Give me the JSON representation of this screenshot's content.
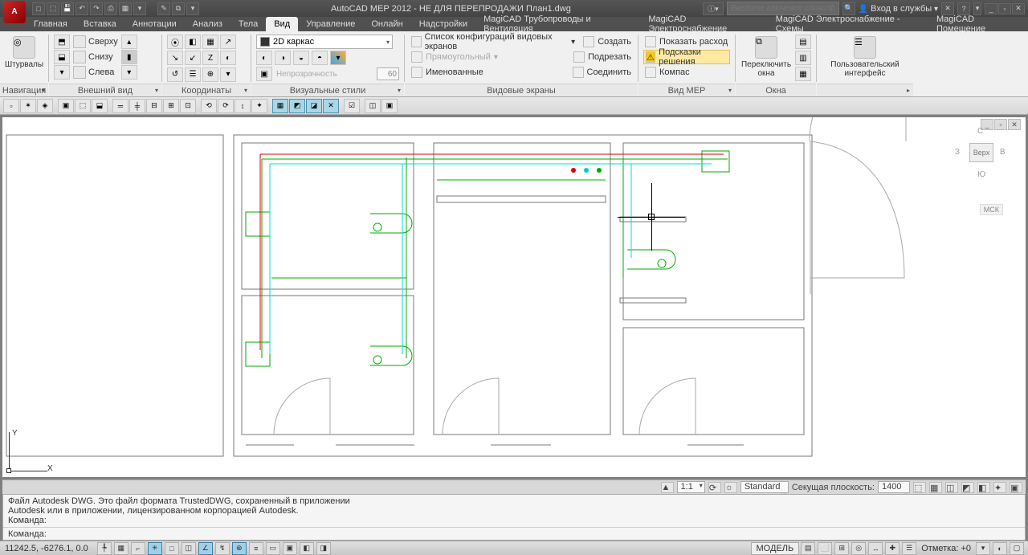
{
  "title": "AutoCAD MEP 2012 - НЕ ДЛЯ ПЕРЕПРОДАЖИ   План1.dwg",
  "search_placeholder": "Введите ключевое слово/фразу",
  "login_label": "Вход в службы",
  "menus": [
    "Главная",
    "Вставка",
    "Аннотации",
    "Анализ",
    "Тела",
    "Вид",
    "Управление",
    "Онлайн",
    "Надстройки",
    "MagiCAD Трубопроводы и Вентиляция",
    "MagiCAD Электроснабжение",
    "MagiCAD Электроснабжение - Схемы",
    "MagiCAD Помещение"
  ],
  "active_menu_index": 5,
  "ribbon": {
    "nav": {
      "big": "Штурвалы",
      "panel": "Навигация"
    },
    "views": {
      "items": [
        "Сверху",
        "Снизу",
        "Слева"
      ],
      "panel": "Внешний вид"
    },
    "coords": {
      "panel": "Координаты"
    },
    "visual": {
      "combo": "2D каркас",
      "opacity_label": "Непрозрачность",
      "opacity_val": "60",
      "panel": "Визуальные стили"
    },
    "viewports": {
      "conf": "Список конфигураций видовых экранов",
      "rect": "Прямоугольный",
      "named": "Именованные",
      "create": "Создать",
      "trim": "Подрезать",
      "join": "Соединить",
      "panel": "Видовые экраны"
    },
    "mep": {
      "flow": "Показать расход",
      "hints": "Подсказки решения",
      "compass": "Компас",
      "panel": "Вид MEP"
    },
    "windows": {
      "switch": "Переключить окна",
      "panel": "Окна"
    },
    "ui": {
      "label": "Пользовательский интерфейс"
    }
  },
  "viewcube": {
    "face": "Верх",
    "n": "С",
    "s": "Ю",
    "e": "В",
    "w": "З",
    "wcs": "МСК"
  },
  "ucs": {
    "x": "X",
    "y": "Y"
  },
  "anno": {
    "scale": "1:1",
    "std": "Standard",
    "section_lbl": "Секущая плоскость:",
    "section_val": "1400"
  },
  "cmd_hist": "Файл Autodesk DWG. Это файл формата TrustedDWG, сохраненный в приложении\nAutodesk или в приложении, лицензированном корпорацией Autodesk.\nКоманда:",
  "cmd_prompt": "Команда:",
  "status": {
    "coords": "11242.5, -6276.1, 0.0",
    "model": "МОДЕЛЬ",
    "mark": "Отметка: +0"
  }
}
